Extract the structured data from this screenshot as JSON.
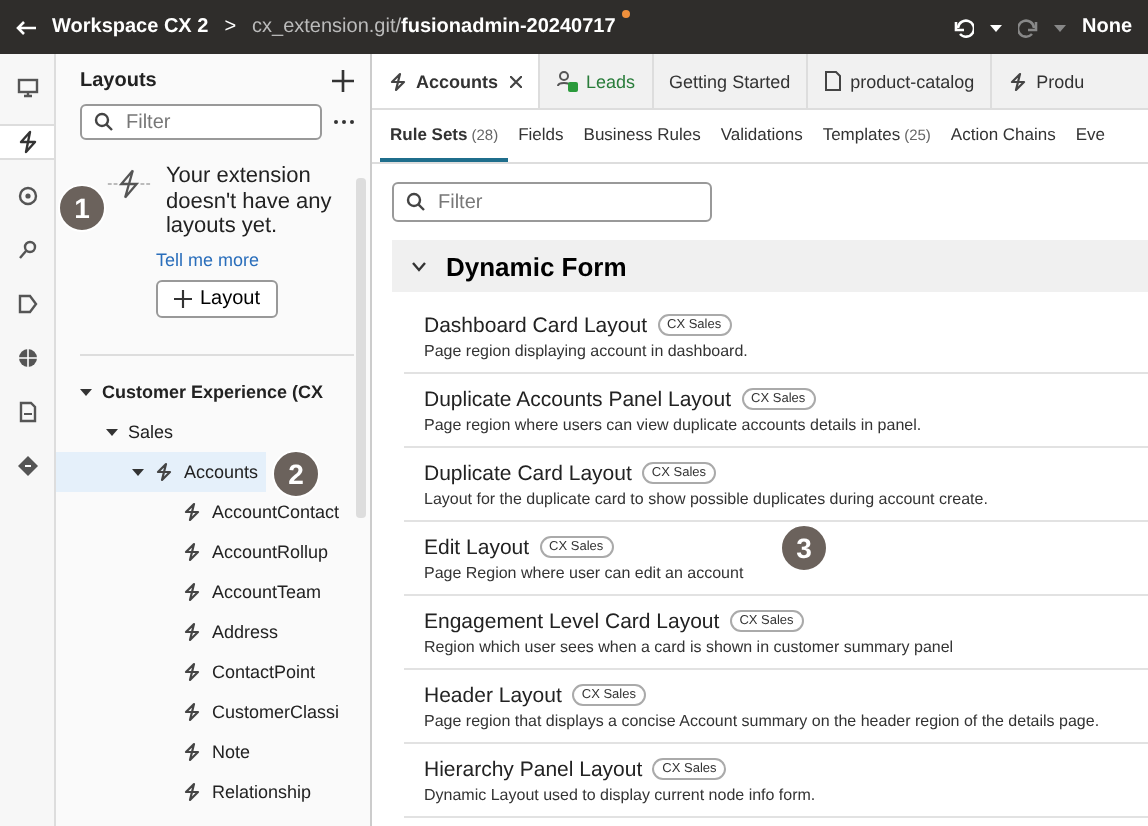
{
  "top_bar": {
    "workspace": "Workspace CX 2",
    "separator": ">",
    "repo": "cx_extension.git/",
    "branch": "fusionadmin-20240717",
    "modified": true,
    "profile": "None"
  },
  "rail": [
    {
      "selected": false
    },
    {
      "selected": true
    },
    {
      "selected": false
    },
    {
      "selected": false
    },
    {
      "selected": false
    },
    {
      "selected": false
    },
    {
      "selected": false
    },
    {
      "selected": false
    }
  ],
  "layouts_panel": {
    "title": "Layouts",
    "filter_placeholder": "Filter",
    "empty_message": "Your extension doesn't have any layouts yet.",
    "link": "Tell me more",
    "button": "Layout",
    "tree": [
      {
        "label": "Customer Experience (CX",
        "expanded": true,
        "selected": false,
        "children": [
          {
            "label": "Sales",
            "expanded": true,
            "selected": false,
            "children": [
              {
                "label": "Accounts",
                "expanded": true,
                "selected": true,
                "children": [
                  {
                    "label": "AccountContact",
                    "selected": false
                  },
                  {
                    "label": "AccountRollup",
                    "selected": false
                  },
                  {
                    "label": "AccountTeam",
                    "selected": false
                  },
                  {
                    "label": "Address",
                    "selected": false
                  },
                  {
                    "label": "ContactPoint",
                    "selected": false
                  },
                  {
                    "label": "CustomerClassi",
                    "selected": false
                  },
                  {
                    "label": "Note",
                    "selected": false
                  },
                  {
                    "label": "Relationship",
                    "selected": false
                  }
                ]
              }
            ]
          }
        ]
      }
    ]
  },
  "tabs": [
    {
      "kind": "layout",
      "label": "Accounts",
      "selected": true,
      "closable": true
    },
    {
      "kind": "leads",
      "label": "Leads",
      "selected": false,
      "closable": false
    },
    {
      "kind": "plain",
      "label": "Getting Started",
      "selected": false,
      "closable": false
    },
    {
      "kind": "file",
      "label": "product-catalog",
      "selected": false,
      "closable": false
    },
    {
      "kind": "layout",
      "label": "Produ",
      "selected": false,
      "closable": false
    }
  ],
  "subtabs": [
    {
      "label": "Rule Sets",
      "count": "(28)",
      "selected": true
    },
    {
      "label": "Fields",
      "selected": false
    },
    {
      "label": "Business Rules",
      "selected": false
    },
    {
      "label": "Validations",
      "selected": false
    },
    {
      "label": "Templates",
      "count": "(25)",
      "selected": false
    },
    {
      "label": "Action Chains",
      "selected": false
    },
    {
      "label": "Eve",
      "selected": false
    }
  ],
  "filter_placeholder": "Filter",
  "section": {
    "title": "Dynamic Form",
    "expanded": true
  },
  "items": [
    {
      "title": "Dashboard Card Layout",
      "tag": "CX Sales",
      "description": "Page region displaying account in dashboard."
    },
    {
      "title": "Duplicate Accounts Panel Layout",
      "tag": "CX Sales",
      "description": "Page region where users can view duplicate accounts details in panel."
    },
    {
      "title": "Duplicate Card Layout",
      "tag": "CX Sales",
      "description": "Layout for the duplicate card to show possible duplicates during account create."
    },
    {
      "title": "Edit Layout",
      "tag": "CX Sales",
      "description": "Page Region where user can edit an account"
    },
    {
      "title": "Engagement Level Card Layout",
      "tag": "CX Sales",
      "description": "Region which user sees when a card is shown in customer summary panel"
    },
    {
      "title": "Header Layout",
      "tag": "CX Sales",
      "description": "Page region that displays a concise Account summary on the header region of the details page."
    },
    {
      "title": "Hierarchy Panel Layout",
      "tag": "CX Sales",
      "description": "Dynamic Layout used to display current node info form."
    }
  ],
  "callouts": [
    "1",
    "2",
    "3"
  ]
}
